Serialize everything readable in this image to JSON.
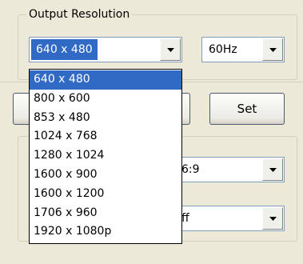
{
  "output_resolution": {
    "group_title": "Output Resolution",
    "resolution_value": "640 x 480",
    "refresh_value": "60Hz",
    "set_label": "Set"
  },
  "lower_panel": {
    "aspect_value_visible": "6:9",
    "mode_value_visible": "ff"
  },
  "resolution_options": [
    "640 x 480",
    "800 x 600",
    "853 x 480",
    "1024 x 768",
    "1280 x 1024",
    "1600 x 900",
    "1600 x 1200",
    "1706 x 960",
    "1920 x 1080p"
  ],
  "colors": {
    "selection": "#316ac5",
    "window_bg": "#ece9d8"
  },
  "icons": {
    "dropdown_arrow": "chevron-down-icon"
  }
}
